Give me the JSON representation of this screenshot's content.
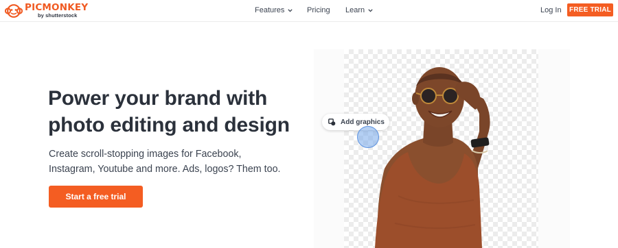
{
  "brand": {
    "name": "PICMONKEY",
    "byline": "by shutterstock",
    "accent": "#f45d22"
  },
  "nav": {
    "items": [
      {
        "label": "Features",
        "has_dropdown": true
      },
      {
        "label": "Pricing",
        "has_dropdown": false
      },
      {
        "label": "Learn",
        "has_dropdown": true
      }
    ],
    "login_label": "Log In",
    "trial_label": "FREE TRIAL"
  },
  "hero": {
    "title": "Power your brand with photo editing and design",
    "subtitle": "Create scroll-stopping images for Facebook, Instagram, Youtube and more. Ads, logos? Them too.",
    "cta_label": "Start a free trial"
  },
  "demo": {
    "tooltip_label": "Add graphics",
    "tooltip_icon": "add-graphics-icon"
  }
}
